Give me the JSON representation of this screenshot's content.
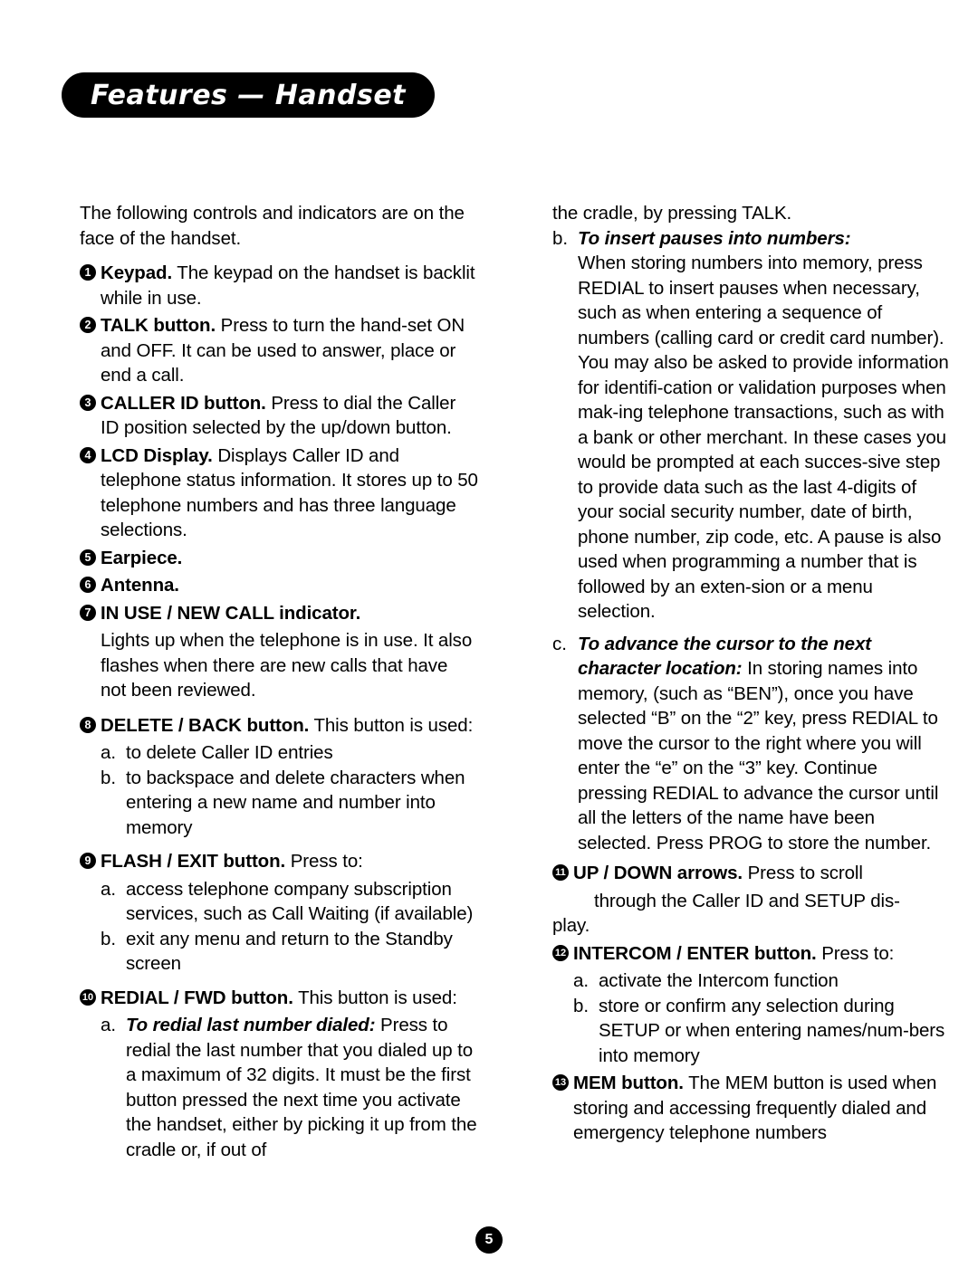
{
  "header": {
    "title": "Features — Handset"
  },
  "page_number": "5",
  "left_column": {
    "intro": "The following controls and indicators are on the face of the handset.",
    "items": [
      {
        "num": "1",
        "bold": "Keypad.",
        "text": " The keypad on the handset is backlit while in use."
      },
      {
        "num": "2",
        "bold": "TALK button.",
        "text": " Press to turn the hand-set ON and OFF. It can be used to answer, place or end a call."
      },
      {
        "num": "3",
        "bold": "CALLER ID button.",
        "text": " Press to dial the Caller ID position selected by the up/down button."
      },
      {
        "num": "4",
        "bold": "LCD Display.",
        "text": " Displays Caller ID and telephone status information. It stores up to 50 telephone numbers and has three language selections."
      },
      {
        "num": "5",
        "bold": "Earpiece.",
        "text": ""
      },
      {
        "num": "6",
        "bold": "Antenna.",
        "text": ""
      },
      {
        "num": "7",
        "bold": "IN USE / NEW CALL indicator.",
        "text": ""
      }
    ],
    "item7_body": "Lights up when the telephone is in use. It also flashes when there are new calls that have not been reviewed.",
    "item8": {
      "num": "8",
      "bold": "DELETE / BACK button.",
      "text": " This button is used:"
    },
    "item8_subs": [
      {
        "ltr": "a.",
        "text": "to delete Caller ID entries"
      },
      {
        "ltr": "b.",
        "text": "to backspace and delete characters when entering a new name and number into memory"
      }
    ],
    "item9": {
      "num": "9",
      "bold": "FLASH / EXIT button.",
      "text": " Press to:"
    },
    "item9_subs": [
      {
        "ltr": "a.",
        "text": "access telephone company subscription services, such as Call Waiting (if available)"
      },
      {
        "ltr": "b.",
        "text": "exit any menu and return to the Standby screen"
      }
    ],
    "item10": {
      "num": "10",
      "bold": "REDIAL / FWD button.",
      "text": " This button is used:"
    },
    "item10_sub_a_ltr": "a.",
    "item10_sub_a_bolditalic": "To redial last number dialed:",
    "item10_sub_a_text": " Press to redial the last number that you dialed up to a maximum of 32 digits. It must be the first button pressed the next time you activate the handset, either by picking it up from the cradle or, if out of"
  },
  "right_column": {
    "cont_top": "the cradle, by pressing TALK.",
    "sub_b_ltr": "b.",
    "sub_b_bolditalic": "To insert pauses into numbers:",
    "sub_b_text": "When storing numbers into memory, press REDIAL to insert pauses when necessary, such as when entering a sequence of numbers (calling card or credit card number). You may also be asked to provide information for identifi-cation or validation purposes when mak-ing telephone transactions, such as with a bank or other merchant. In these cases you would be prompted at each succes-sive step to provide data such as the last 4-digits of your social security number, date of birth, phone number, zip code, etc. A pause is also used when programming a number that is followed by an exten-sion or a menu selection.",
    "sub_c_ltr": "c.",
    "sub_c_bolditalic": "To advance the cursor to the next character location:",
    "sub_c_text": "  In storing names into memory, (such as “BEN”), once you have selected “B” on the “2” key, press REDIAL to move the cursor to the right where you will enter the “e” on the “3” key. Continue pressing REDIAL to advance the cursor until all the letters of the name have been selected. Press PROG to store the number.",
    "item11": {
      "num": "11",
      "bold": "UP / DOWN arrows.",
      "text": " Press to scroll"
    },
    "item11_body_l2": "through the Caller ID and SETUP dis-",
    "item11_body_l3": "play.",
    "item12": {
      "num": "12",
      "bold": "INTERCOM / ENTER button.",
      "text": " Press to:"
    },
    "item12_subs": [
      {
        "ltr": "a.",
        "text": "activate the Intercom function"
      },
      {
        "ltr": "b.",
        "text": "store or confirm any selection during SETUP or when entering names/num-bers into memory"
      }
    ],
    "item13": {
      "num": "13",
      "bold": "MEM button.",
      "text": " The MEM button is used when storing and accessing frequently dialed and emergency telephone numbers"
    }
  }
}
